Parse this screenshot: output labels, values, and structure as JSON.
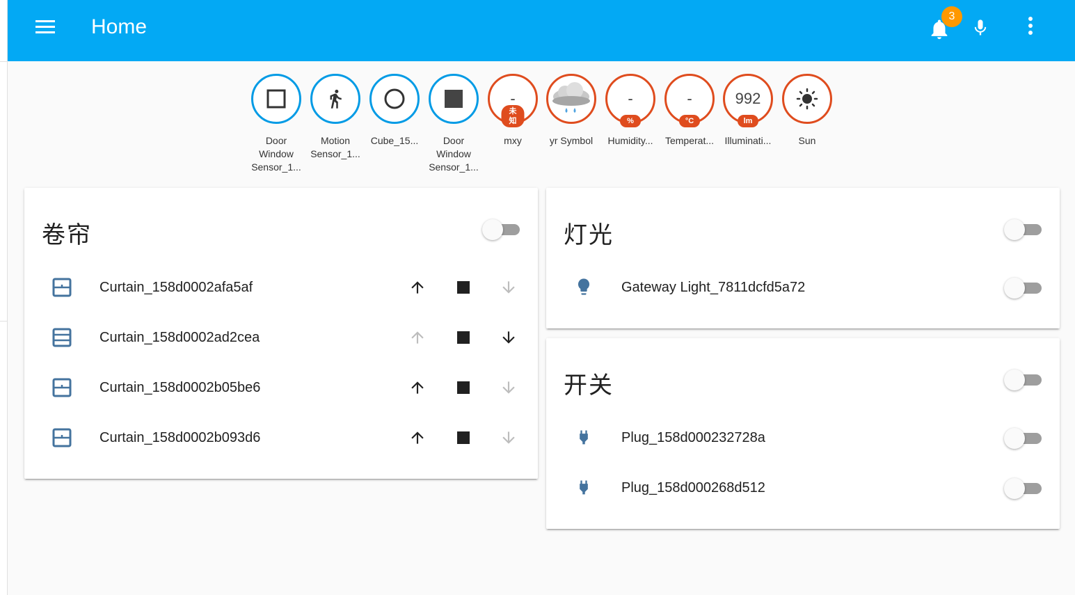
{
  "header": {
    "title": "Home",
    "notification_count": "3"
  },
  "badges": [
    {
      "value": "",
      "unit": "",
      "label_lines": [
        "Door",
        "Window",
        "Sensor_1..."
      ],
      "icon": "square-outline-icon"
    },
    {
      "value": "",
      "unit": "",
      "label_lines": [
        "Motion",
        "Sensor_1..."
      ],
      "icon": "walk-icon"
    },
    {
      "value": "",
      "unit": "",
      "label_lines": [
        "Cube_15..."
      ],
      "icon": "circle-outline-icon"
    },
    {
      "value": "",
      "unit": "",
      "label_lines": [
        "Door",
        "Window",
        "Sensor_1..."
      ],
      "icon": "square-filled-icon"
    },
    {
      "value": "-",
      "unit": "未知",
      "label_lines": [
        "mxy"
      ],
      "icon": ""
    },
    {
      "value": "",
      "unit": "",
      "label_lines": [
        "yr Symbol"
      ],
      "icon": "rain-cloud-icon"
    },
    {
      "value": "-",
      "unit": "%",
      "label_lines": [
        "Humidity..."
      ],
      "icon": ""
    },
    {
      "value": "-",
      "unit": "°C",
      "label_lines": [
        "Temperat..."
      ],
      "icon": ""
    },
    {
      "value": "992",
      "unit": "lm",
      "label_lines": [
        "Illuminati..."
      ],
      "icon": ""
    },
    {
      "value": "",
      "unit": "",
      "label_lines": [
        "Sun"
      ],
      "icon": "sun-icon"
    }
  ],
  "curtains": {
    "title": "卷帘",
    "items": [
      {
        "name": "Curtain_158d0002afa5af",
        "up_enabled": true,
        "down_enabled": false
      },
      {
        "name": "Curtain_158d0002ad2cea",
        "up_enabled": false,
        "down_enabled": true
      },
      {
        "name": "Curtain_158d0002b05be6",
        "up_enabled": true,
        "down_enabled": false
      },
      {
        "name": "Curtain_158d0002b093d6",
        "up_enabled": true,
        "down_enabled": false
      }
    ]
  },
  "lights": {
    "title": "灯光",
    "items": [
      {
        "name": "Gateway Light_7811dcfd5a72",
        "on": false
      }
    ]
  },
  "switches": {
    "title": "开关",
    "items": [
      {
        "name": "Plug_158d000232728a",
        "on": false
      },
      {
        "name": "Plug_158d000268d512",
        "on": false
      }
    ]
  },
  "colors": {
    "header": "#03a9f4",
    "badge_blue": "#039be5",
    "badge_red": "#df4c1e",
    "notification": "#ff9800",
    "entity_icon": "#44739e"
  }
}
